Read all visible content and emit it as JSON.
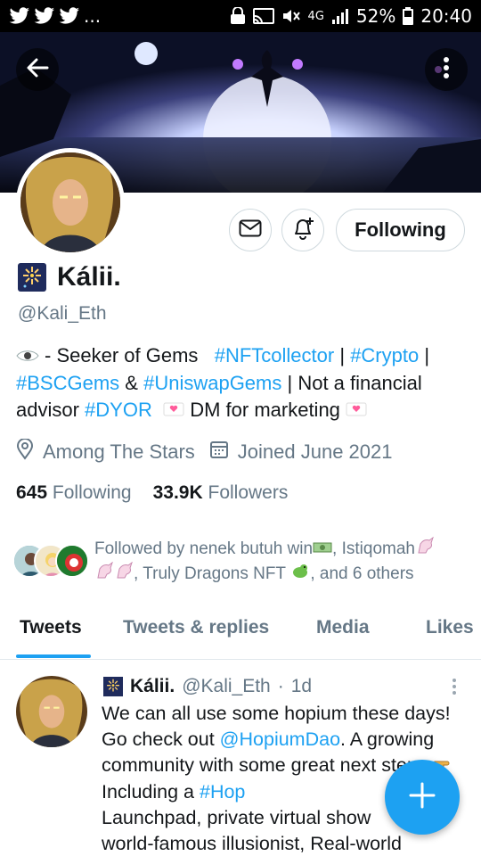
{
  "status_bar": {
    "battery": "52%",
    "time": "20:40",
    "network": "4G",
    "notification_icons": [
      "twitter-icon",
      "twitter-icon",
      "twitter-icon",
      "more-notifications"
    ],
    "more_label": "..."
  },
  "profile": {
    "name": "Kálii.",
    "handle": "@Kali_Eth",
    "follow_button": "Following",
    "bio": {
      "seg1": "- Seeker of Gems",
      "tag1": "#NFTcollector",
      "sep1": "|",
      "tag2": "#Crypto",
      "sep2": "|",
      "tag3": "#BSCGems",
      "amp": "&",
      "tag4": "#UniswapGems",
      "seg2": "| Not a financial advisor",
      "tag5": "#DYOR",
      "seg3": "DM for marketing"
    },
    "location": "Among The Stars",
    "joined": "Joined June 2021",
    "following_count": "645",
    "following_label": "Following",
    "followers_count": "33.9K",
    "followers_label": "Followers",
    "followed_by": {
      "prefix": "Followed by nenek butuh win",
      "name2": ", Istiqomah",
      "name3": ", Truly Dragons NFT",
      "suffix": ", and 6 others"
    }
  },
  "tabs": [
    {
      "label": "Tweets",
      "active": true
    },
    {
      "label": "Tweets & replies",
      "active": false
    },
    {
      "label": "Media",
      "active": false
    },
    {
      "label": "Likes",
      "active": false
    }
  ],
  "tweet": {
    "name": "Kálii.",
    "handle": "@Kali_Eth",
    "separator": "·",
    "time": "1d",
    "text1": "We can all use some hopium these days! Go check out",
    "mention": "@HopiumDao",
    "text2": ". A growing community with some great next steps",
    "text3": "Including a",
    "tag": "#Hop",
    "text4": "Launchpad, private virtual show",
    "text5": "world-famous illusionist, Real-world"
  },
  "colors": {
    "accent": "#1da1f2",
    "text_primary": "#14171a",
    "text_secondary": "#657786",
    "border": "#cfd9de"
  }
}
